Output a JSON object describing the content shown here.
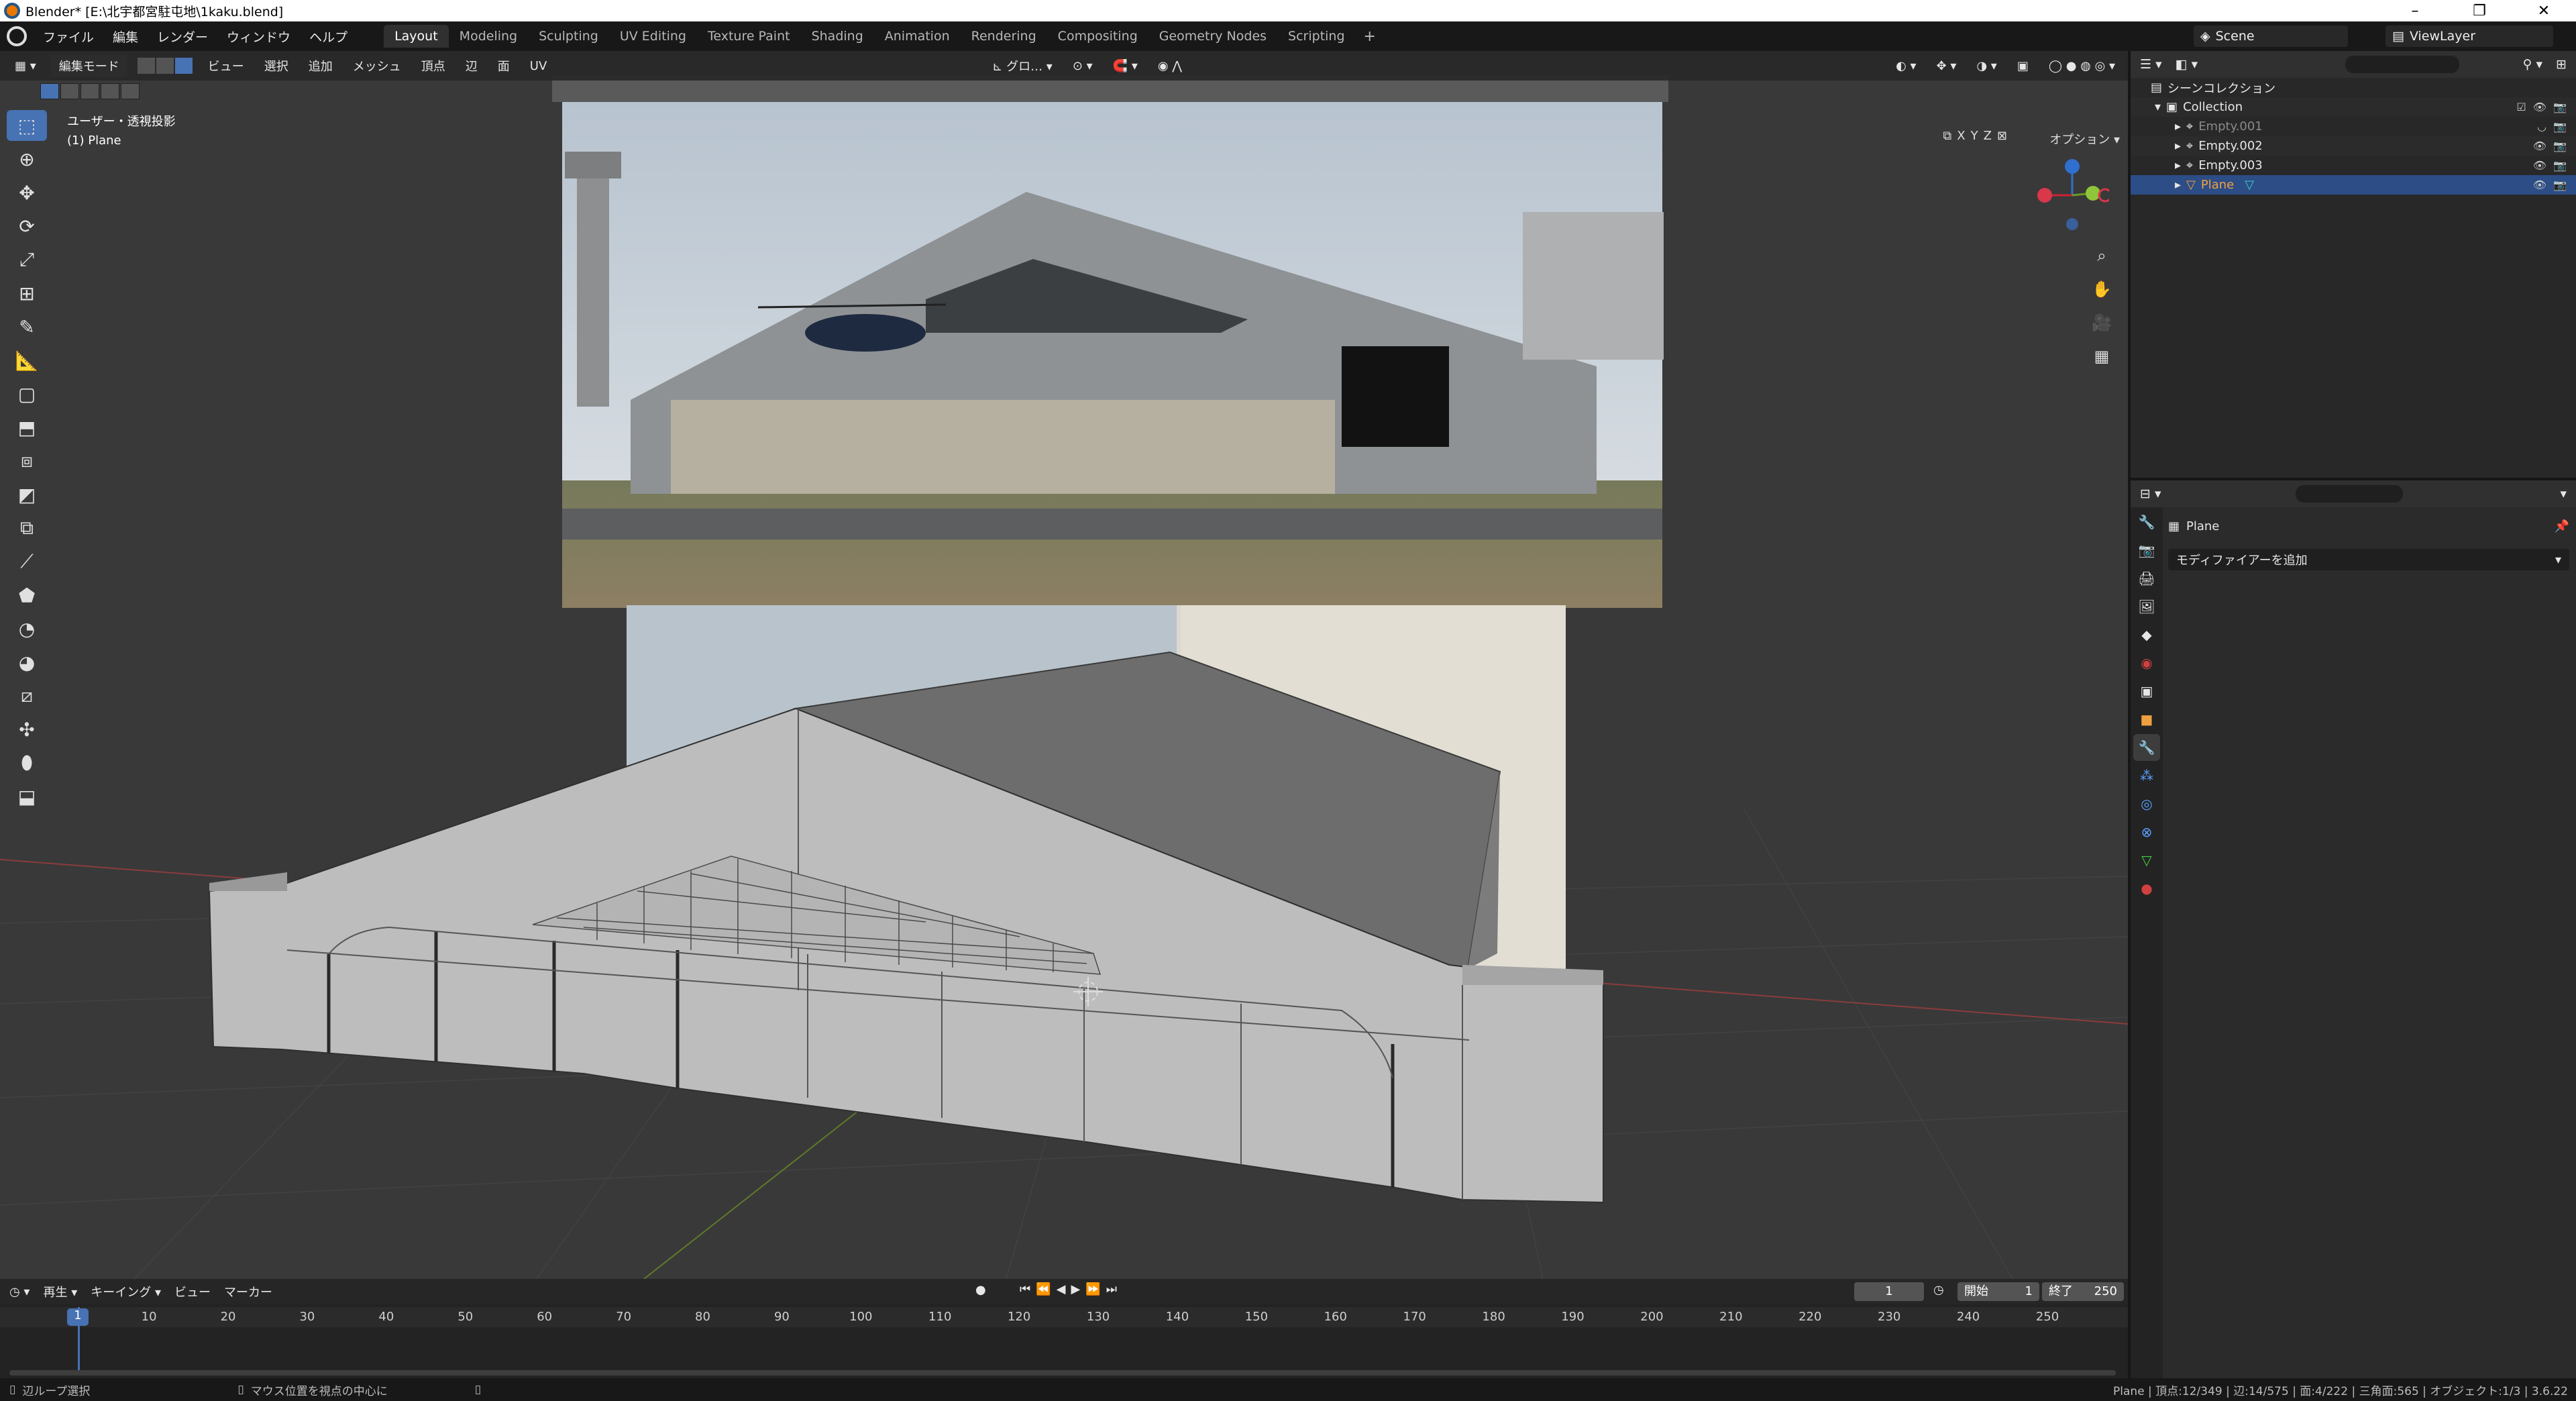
{
  "window": {
    "title": "Blender* [E:\\北宇都宮駐屯地\\1kaku.blend]",
    "minimize": "–",
    "maximize": "❐",
    "close": "✕"
  },
  "menu": [
    "ファイル",
    "編集",
    "レンダー",
    "ウィンドウ",
    "ヘルプ"
  ],
  "workspaces": [
    "Layout",
    "Modeling",
    "Sculpting",
    "UV Editing",
    "Texture Paint",
    "Shading",
    "Animation",
    "Rendering",
    "Compositing",
    "Geometry Nodes",
    "Scripting"
  ],
  "active_workspace": "Layout",
  "scene": {
    "name": "Scene",
    "view_layer": "ViewLayer"
  },
  "viewport": {
    "mode": "編集モード",
    "header_menu": [
      "ビュー",
      "選択",
      "追加",
      "メッシュ",
      "頂点",
      "辺",
      "面",
      "UV"
    ],
    "transform": "グロ…",
    "view_label": "ユーザー・透視投影",
    "object_label": "(1) Plane",
    "options": "オプション",
    "axes": [
      "X",
      "Y",
      "Z"
    ]
  },
  "timeline": {
    "menu": [
      "再生",
      "キーイング",
      "ビュー",
      "マーカー"
    ],
    "current_frame": "1",
    "start_label": "開始",
    "start": "1",
    "end_label": "終了",
    "end": "250",
    "ticks": [
      "10",
      "20",
      "30",
      "40",
      "50",
      "60",
      "70",
      "80",
      "90",
      "100",
      "110",
      "120",
      "130",
      "140",
      "150",
      "160",
      "170",
      "180",
      "190",
      "200",
      "210",
      "220",
      "230",
      "240",
      "250"
    ]
  },
  "outliner": {
    "root": "シーンコレクション",
    "collection": "Collection",
    "items": [
      {
        "name": "Empty.001",
        "dimmed": true
      },
      {
        "name": "Empty.002",
        "dimmed": false
      },
      {
        "name": "Empty.003",
        "dimmed": false
      },
      {
        "name": "Plane",
        "selected": true
      }
    ]
  },
  "properties": {
    "object_name": "Plane",
    "add_modifier": "モディファイアーを追加"
  },
  "status": {
    "left": "辺ループ選択",
    "middle": "マウス位置を視点の中心に",
    "right": "Plane | 頂点:12/349 | 辺:14/575 | 面:4/222 | 三角面:565 | オブジェクト:1/3 | 3.6.22"
  },
  "colors": {
    "accent": "#4772b3",
    "selected_row": "#2c4d85",
    "viewport_bg": "#393939"
  }
}
